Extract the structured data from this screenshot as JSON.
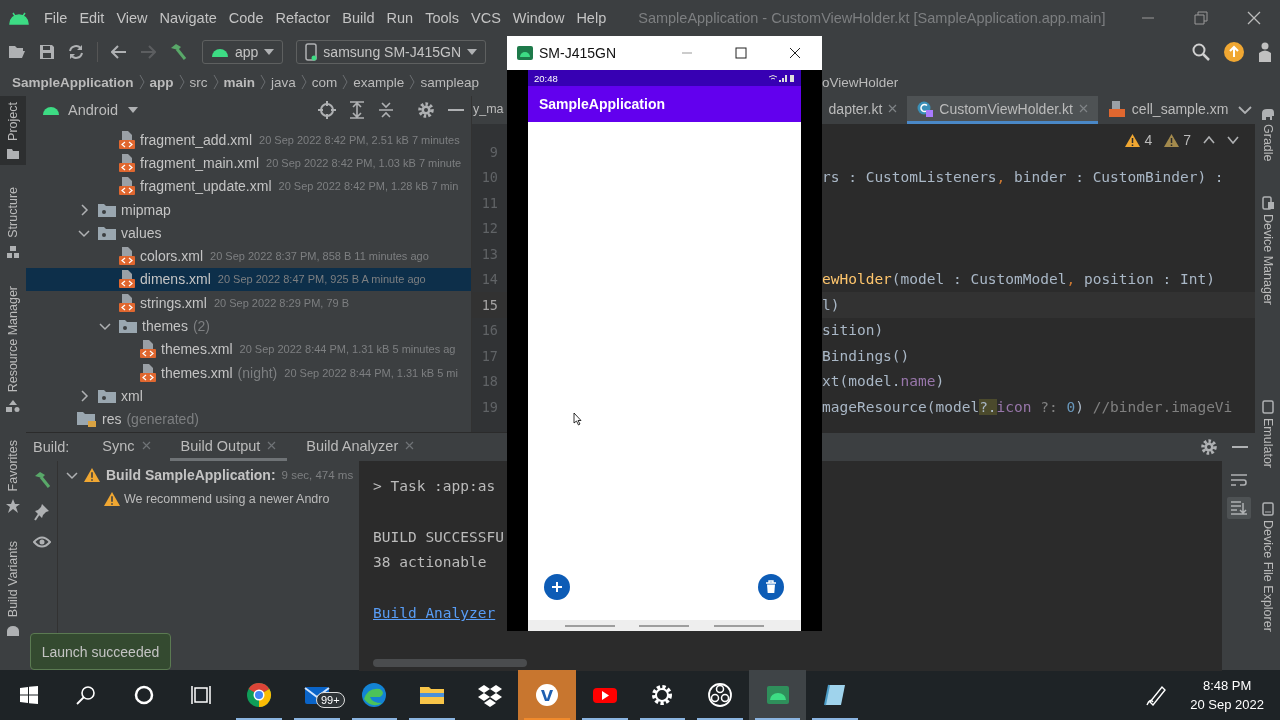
{
  "title_bar": {
    "menu": [
      "File",
      "Edit",
      "View",
      "Navigate",
      "Code",
      "Refactor",
      "Build",
      "Run",
      "Tools",
      "VCS",
      "Window",
      "Help"
    ],
    "title": "SampleApplication - CustomViewHolder.kt [SampleApplication.app.main]"
  },
  "toolbar": {
    "config": "app",
    "device": "samsung SM-J415GN"
  },
  "breadcrumb": [
    {
      "label": "SampleApplication",
      "bold": true
    },
    {
      "label": "app",
      "bold": true
    },
    {
      "label": "src",
      "bold": false
    },
    {
      "label": "main",
      "bold": true
    },
    {
      "label": "java",
      "bold": false
    },
    {
      "label": "com",
      "bold": false
    },
    {
      "label": "example",
      "bold": false
    },
    {
      "label": "sampleap",
      "bold": false
    }
  ],
  "breadcrumb_end": "oViewHolder",
  "left_stripe": [
    {
      "label": "Project",
      "selected": true
    },
    {
      "label": "Structure",
      "selected": false
    },
    {
      "label": "Resource Manager",
      "selected": false
    }
  ],
  "left_stripe_bottom": [
    "Favorites",
    "Build Variants"
  ],
  "right_stripe": {
    "top": [
      "Gradle",
      "Device Manager"
    ],
    "bottom": [
      "Emulator",
      "Device File Explorer"
    ]
  },
  "project_panel": {
    "view": "Android",
    "tree": [
      {
        "children": [
          {
            "children": [
              {
                "name": "fragment_add.xml",
                "kind": "file",
                "info": "20 Sep 2022 8:42 PM, 2.51 kB 7 minutes",
                "selected": false
              },
              {
                "name": "fragment_main.xml",
                "kind": "file",
                "info": "20 Sep 2022 8:42 PM, 1.03 kB 7 minute",
                "selected": false
              },
              {
                "name": "fragment_update.xml",
                "kind": "file",
                "info": "20 Sep 2022 8:42 PM, 1.28 kB 7 min",
                "selected": false
              }
            ]
          },
          {
            "name": "mipmap",
            "kind": "folder",
            "expanded": false,
            "selected": false
          },
          {
            "name": "values",
            "kind": "folder",
            "expanded": true,
            "selected": false,
            "children": [
              {
                "name": "colors.xml",
                "kind": "file",
                "info": "20 Sep 2022 8:37 PM, 858 B 11 minutes ago",
                "selected": false
              },
              {
                "name": "dimens.xml",
                "kind": "file",
                "info": "20 Sep 2022 8:47 PM, 925 B A minute ago",
                "selected": true
              },
              {
                "name": "strings.xml",
                "kind": "file",
                "info": "20 Sep 2022 8:29 PM, 79 B",
                "selected": false
              },
              {
                "name": "themes",
                "note": "(2)",
                "kind": "folder",
                "expanded": true,
                "selected": false,
                "children": [
                  {
                    "name": "themes.xml",
                    "kind": "file",
                    "info": "20 Sep 2022 8:44 PM, 1.31 kB 5 minutes ag",
                    "selected": false
                  },
                  {
                    "name": "themes.xml",
                    "note": "(night)",
                    "kind": "file",
                    "info": "20 Sep 2022 8:44 PM, 1.31 kB 5 mi",
                    "selected": false
                  }
                ]
              }
            ]
          },
          {
            "name": "xml",
            "kind": "folder",
            "expanded": false,
            "selected": false
          }
        ]
      },
      {
        "name": "res",
        "note": "(generated)",
        "kind": "generated",
        "selected": false
      }
    ]
  },
  "editor": {
    "tabs": [
      {
        "label": "y_ma",
        "kind": "plain",
        "closable": false,
        "selected": false
      },
      {
        "label": "dapter.kt",
        "kind": "plain",
        "closable": true,
        "selected": false
      },
      {
        "label": "CustomViewHolder.kt",
        "kind": "class",
        "closable": true,
        "selected": true
      },
      {
        "label": "cell_sample.xm",
        "kind": "layout",
        "closable": false,
        "selected": false
      }
    ],
    "warnings": "4",
    "weak_warnings": "7",
    "lines": [
      {
        "number": "9",
        "current": false
      },
      {
        "number": "10",
        "current": false,
        "segments": [
          {
            "kind": "plain",
            "text": "rs : CustomListeners"
          },
          {
            "kind": "punct",
            "text": ","
          },
          {
            "kind": "plain",
            "text": " binder : CustomBinder) :"
          }
        ]
      },
      {
        "number": "11",
        "current": false
      },
      {
        "number": "12",
        "current": false
      },
      {
        "number": "13",
        "current": false
      },
      {
        "number": "14",
        "current": false,
        "segments": [
          {
            "kind": "fn",
            "text": "ewHolder"
          },
          {
            "kind": "plain",
            "text": "(model : CustomModel"
          },
          {
            "kind": "punct",
            "text": ","
          },
          {
            "kind": "plain",
            "text": " position : Int)"
          }
        ]
      },
      {
        "number": "15",
        "current": true,
        "segments": [
          {
            "kind": "plain",
            "text": "l)"
          }
        ]
      },
      {
        "number": "16",
        "current": false,
        "segments": [
          {
            "kind": "plain",
            "text": "sition)"
          }
        ]
      },
      {
        "number": "17",
        "current": false,
        "segments": [
          {
            "kind": "plain",
            "text": "Bindings()"
          }
        ]
      },
      {
        "number": "18",
        "current": false,
        "segments": [
          {
            "kind": "plain",
            "text": "xt(model."
          },
          {
            "kind": "field",
            "text": "name"
          },
          {
            "kind": "plain",
            "text": ")"
          }
        ]
      },
      {
        "number": "19",
        "current": false,
        "segments": [
          {
            "kind": "plain",
            "text": "mageResource(model"
          },
          {
            "kind": "highlight",
            "text": "?."
          },
          {
            "kind": "field",
            "text": "icon"
          },
          {
            "kind": "comment",
            "text": " ?: "
          },
          {
            "kind": "number",
            "text": "0"
          },
          {
            "kind": "plain",
            "text": ") "
          },
          {
            "kind": "comment",
            "text": "//binder.imageVi"
          }
        ]
      }
    ]
  },
  "build_panel": {
    "label": "Build:",
    "tabs": [
      {
        "label": "Sync",
        "selected": false
      },
      {
        "label": "Build Output",
        "selected": true
      },
      {
        "label": "Build Analyzer",
        "selected": false
      }
    ],
    "tree": [
      {
        "title": "Build SampleApplication:",
        "duration": "9 sec, 474 ms",
        "expanded": true,
        "children": [
          "We recommend using a newer Andro"
        ]
      }
    ],
    "console": [
      {
        "kind": "text",
        "text": "> Task :app:as"
      },
      {
        "kind": "blank"
      },
      {
        "kind": "text",
        "text": "BUILD SUCCESSFU"
      },
      {
        "kind": "text",
        "text": "38 actionable"
      },
      {
        "kind": "blank"
      },
      {
        "kind": "link",
        "text": "Build Analyzer"
      }
    ]
  },
  "toast": "Launch succeeded",
  "emulator": {
    "title": "SM-J415GN",
    "time": "20:48",
    "app_title": "SampleApplication"
  },
  "taskbar": {
    "apps": [
      {
        "kind": "chrome",
        "running": true,
        "active": false
      },
      {
        "kind": "mail",
        "running": true,
        "active": false,
        "badge": "99+"
      },
      {
        "kind": "edge",
        "running": true,
        "active": false
      },
      {
        "kind": "explorer",
        "running": true,
        "active": false
      },
      {
        "kind": "dropbox",
        "running": false,
        "active": false
      },
      {
        "kind": "writer",
        "running": true,
        "active": true
      },
      {
        "kind": "youtube",
        "running": true,
        "active": false
      },
      {
        "kind": "settings",
        "running": true,
        "active": false
      },
      {
        "kind": "obs",
        "running": true,
        "active": false
      },
      {
        "kind": "studio",
        "running": true,
        "active": true
      },
      {
        "kind": "notes",
        "running": true,
        "active": false
      }
    ],
    "clock": {
      "time": "8:48 PM",
      "date": "20 Sep 2022"
    }
  }
}
